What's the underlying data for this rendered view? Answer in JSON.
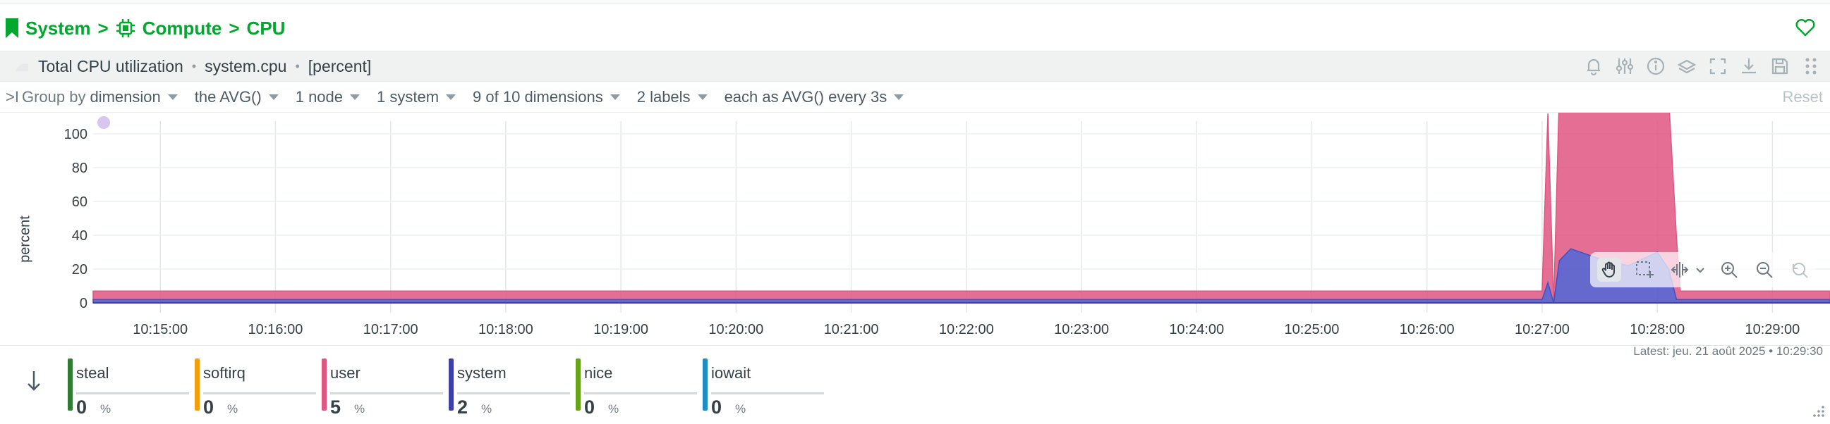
{
  "breadcrumb": {
    "items": [
      "System",
      "Compute",
      "CPU"
    ],
    "sep": ">"
  },
  "title_bar": {
    "title": "Total CPU utilization",
    "context": "system.cpu",
    "units": "[percent]",
    "dot": "•",
    "actions": [
      "bell-icon",
      "sliders-icon",
      "info-icon",
      "stack-icon",
      "expand-icon",
      "download-icon",
      "save-icon",
      "drag-icon"
    ]
  },
  "groupby": {
    "prefix": ">I",
    "label": "Group by",
    "selectors": [
      {
        "name": "group-by",
        "label": "dimension"
      },
      {
        "name": "aggregation",
        "label": "the AVG()"
      },
      {
        "name": "nodes",
        "label": "1 node"
      },
      {
        "name": "instances",
        "label": "1 system"
      },
      {
        "name": "dimensions",
        "label": "9 of 10 dimensions"
      },
      {
        "name": "labels",
        "label": "2 labels"
      },
      {
        "name": "time-aggregation",
        "label": "each as AVG() every 3s"
      }
    ],
    "reset": "Reset"
  },
  "chart": {
    "ylabel": "percent",
    "yticks": [
      "0",
      "20",
      "40",
      "60",
      "80",
      "100"
    ],
    "xticks": [
      "10:15:00",
      "10:16:00",
      "10:17:00",
      "10:18:00",
      "10:19:00",
      "10:20:00",
      "10:21:00",
      "10:22:00",
      "10:23:00",
      "10:24:00",
      "10:25:00",
      "10:26:00",
      "10:27:00",
      "10:28:00",
      "10:29:00"
    ]
  },
  "chart_data": {
    "type": "area",
    "stacked": true,
    "ylim": [
      0,
      100
    ],
    "ylabel": "percent",
    "x_start": "10:14:25",
    "x_end": "10:29:30",
    "grid": true,
    "series": [
      {
        "name": "system",
        "color": "#4a4fc4",
        "points": [
          [
            "10:14:25",
            2
          ],
          [
            "10:27:00",
            2
          ],
          [
            "10:27:03",
            12
          ],
          [
            "10:27:06",
            0
          ],
          [
            "10:27:09",
            25
          ],
          [
            "10:27:15",
            32
          ],
          [
            "10:27:30",
            26
          ],
          [
            "10:27:45",
            22
          ],
          [
            "10:28:00",
            30
          ],
          [
            "10:28:06",
            20
          ],
          [
            "10:28:10",
            2
          ],
          [
            "10:29:30",
            2
          ]
        ]
      },
      {
        "name": "nice",
        "color": "#4caf50",
        "points": [
          [
            "10:14:25",
            0
          ],
          [
            "10:29:30",
            0
          ]
        ]
      },
      {
        "name": "user",
        "color": "#e05581",
        "points": [
          [
            "10:14:25",
            5
          ],
          [
            "10:27:00",
            5
          ],
          [
            "10:27:03",
            100
          ],
          [
            "10:27:06",
            0
          ],
          [
            "10:27:09",
            100
          ],
          [
            "10:28:06",
            100
          ],
          [
            "10:28:12",
            5
          ],
          [
            "10:29:30",
            5
          ]
        ]
      }
    ]
  },
  "toolbar": {
    "tools": [
      "hand-icon",
      "select-area-icon",
      "pan-icon",
      "chevron-down-icon",
      "zoom-in-icon",
      "zoom-out-icon",
      "reset-zoom-icon"
    ]
  },
  "latest": "Latest: jeu. 21 août 2025 • 10:29:30",
  "legend": {
    "items": [
      {
        "name": "steal",
        "value": "0",
        "unit": "%",
        "color": "#2e7d32"
      },
      {
        "name": "softirq",
        "value": "0",
        "unit": "%",
        "color": "#f59e0b"
      },
      {
        "name": "user",
        "value": "5",
        "unit": "%",
        "color": "#e05581"
      },
      {
        "name": "system",
        "value": "2",
        "unit": "%",
        "color": "#3f3fa8"
      },
      {
        "name": "nice",
        "value": "0",
        "unit": "%",
        "color": "#66a319"
      },
      {
        "name": "iowait",
        "value": "0",
        "unit": "%",
        "color": "#1c8ec4"
      }
    ]
  }
}
